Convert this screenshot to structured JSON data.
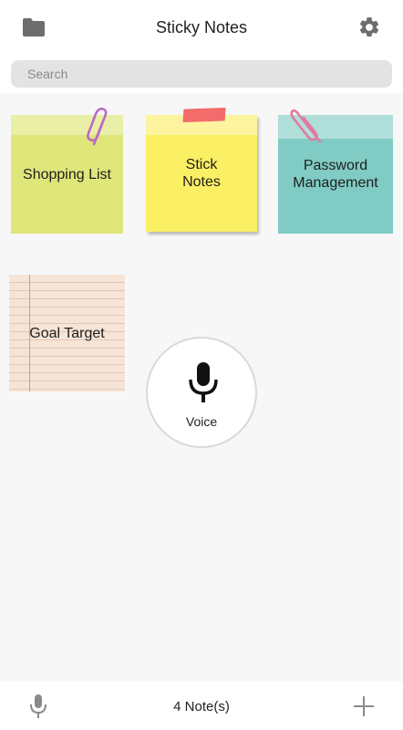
{
  "header": {
    "title": "Sticky Notes",
    "folder_icon": "folder-icon",
    "settings_icon": "gear-icon"
  },
  "search": {
    "placeholder": "Search"
  },
  "notes": [
    {
      "title": "Shopping List",
      "color": "#dfe67a",
      "decoration": "paperclip"
    },
    {
      "title": "Stick\nNotes",
      "color": "#fbef63",
      "decoration": "tape"
    },
    {
      "title": "Password\nManagement",
      "color": "#80cbc4",
      "decoration": "paperclip"
    },
    {
      "title": "Goal Target",
      "color": "#f6e4d7",
      "decoration": "lined-paper"
    }
  ],
  "voice_button": {
    "label": "Voice",
    "icon": "microphone-icon"
  },
  "footer": {
    "note_count": "4 Note(s)",
    "mic_icon": "microphone-icon",
    "add_icon": "plus-icon"
  }
}
